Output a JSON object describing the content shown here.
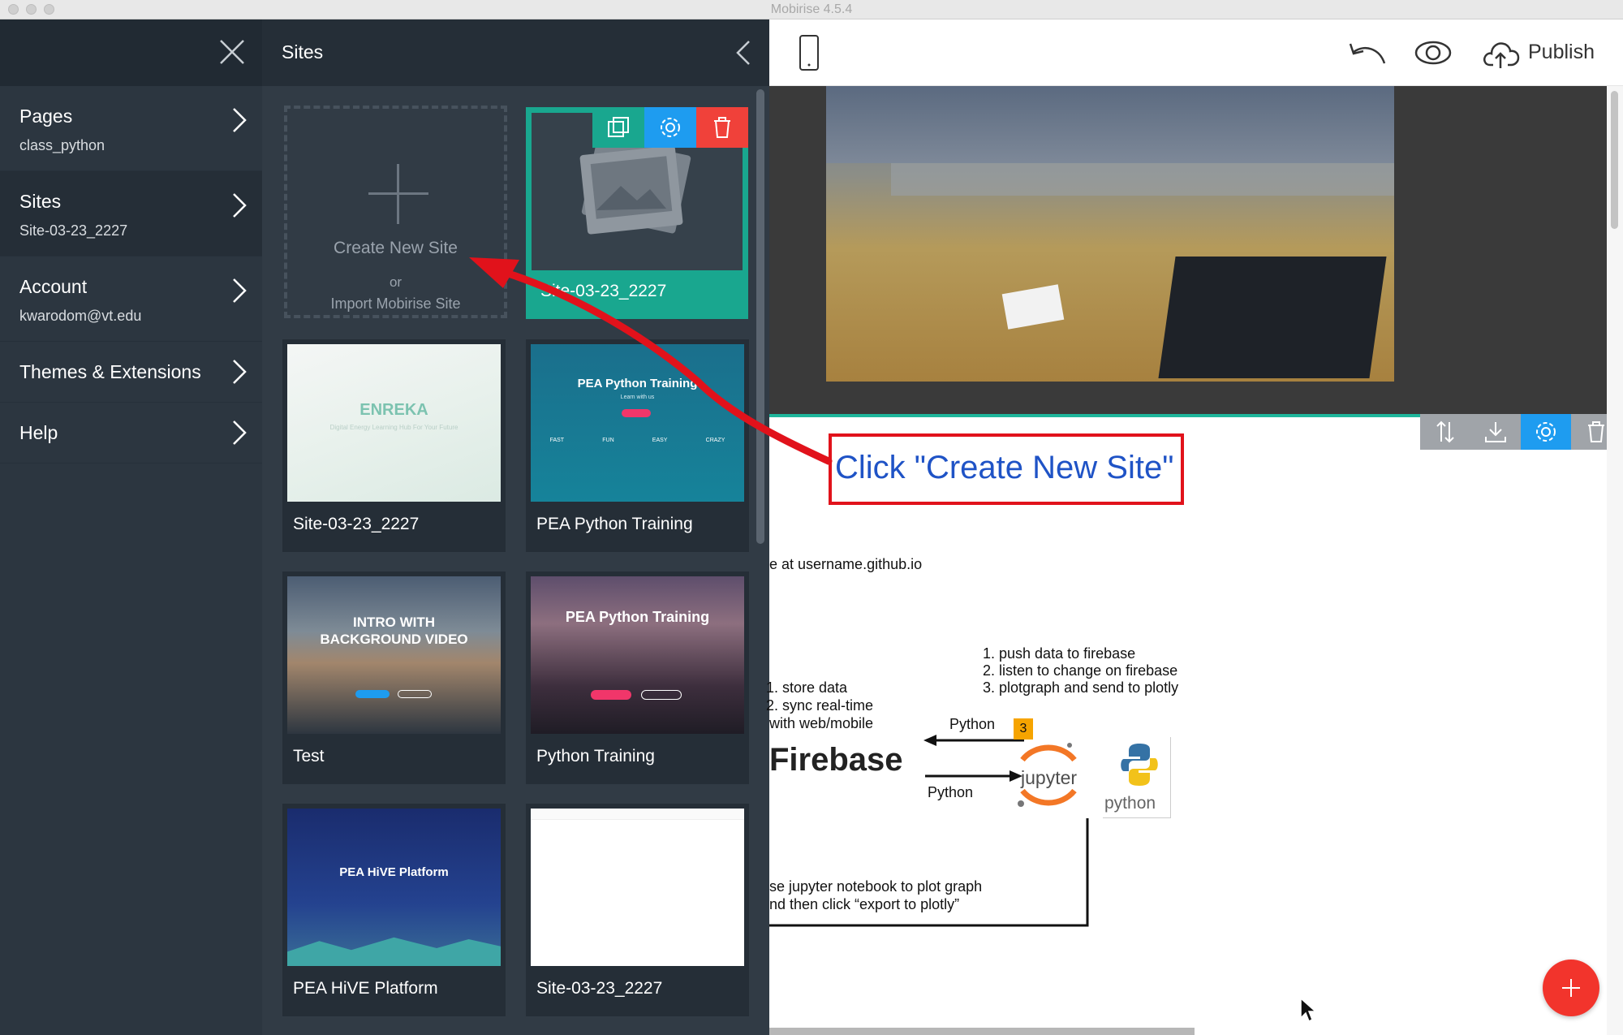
{
  "window": {
    "title": "Mobirise 4.5.4"
  },
  "menu": {
    "items": [
      {
        "label": "Pages",
        "sub": "class_python"
      },
      {
        "label": "Sites",
        "sub": "Site-03-23_2227"
      },
      {
        "label": "Account",
        "sub": "kwarodom@vt.edu"
      },
      {
        "label": "Themes & Extensions",
        "sub": ""
      },
      {
        "label": "Help",
        "sub": ""
      }
    ]
  },
  "sites_panel": {
    "title": "Sites",
    "create": {
      "label": "Create New Site",
      "or": "or",
      "import": "Import Mobirise Site"
    },
    "selected_site": {
      "name": "Site-03-23_2227"
    },
    "tiles": [
      {
        "name": "Site-03-23_2227",
        "thumb_title": "ENREKA",
        "thumb_sub": "Digital Energy Learning Hub For Your Future"
      },
      {
        "name": "PEA Python Training",
        "thumb_title": "PEA Python Training",
        "thumb_sub": "Learn with us",
        "features": [
          "FAST",
          "FUN",
          "EASY",
          "CRAZY"
        ]
      },
      {
        "name": "Test",
        "thumb_title": "INTRO WITH BACKGROUND VIDEO"
      },
      {
        "name": "Python Training",
        "thumb_title": "PEA Python Training"
      },
      {
        "name": "PEA HiVE Platform",
        "thumb_title": "PEA HiVE Platform"
      },
      {
        "name": "Site-03-23_2227"
      }
    ]
  },
  "editor": {
    "publish_label": "Publish",
    "callout": "Click \"Create New Site\"",
    "lines": {
      "github": "e at username.github.io",
      "firebase_steps": [
        "1. store data",
        "2. sync real-time",
        "with web/mobile"
      ],
      "jupyter_steps": [
        "1. push data to firebase",
        "2. listen to change on firebase",
        "3. plotgraph and send to plotly"
      ],
      "python_top": "Python",
      "python_bottom": "Python",
      "badge": "3",
      "firebase_logo": "Firebase",
      "jupyter_logo": "jupyter",
      "python_logo": "python",
      "bottom_note": [
        "se jupyter notebook to plot graph",
        "nd then click “export to plotly”"
      ]
    }
  },
  "colors": {
    "accent_teal": "#19a78f",
    "action_blue": "#1e9cf0",
    "delete_red": "#f0413a",
    "callout_red": "#e1121b",
    "callout_text": "#1f53c6"
  }
}
